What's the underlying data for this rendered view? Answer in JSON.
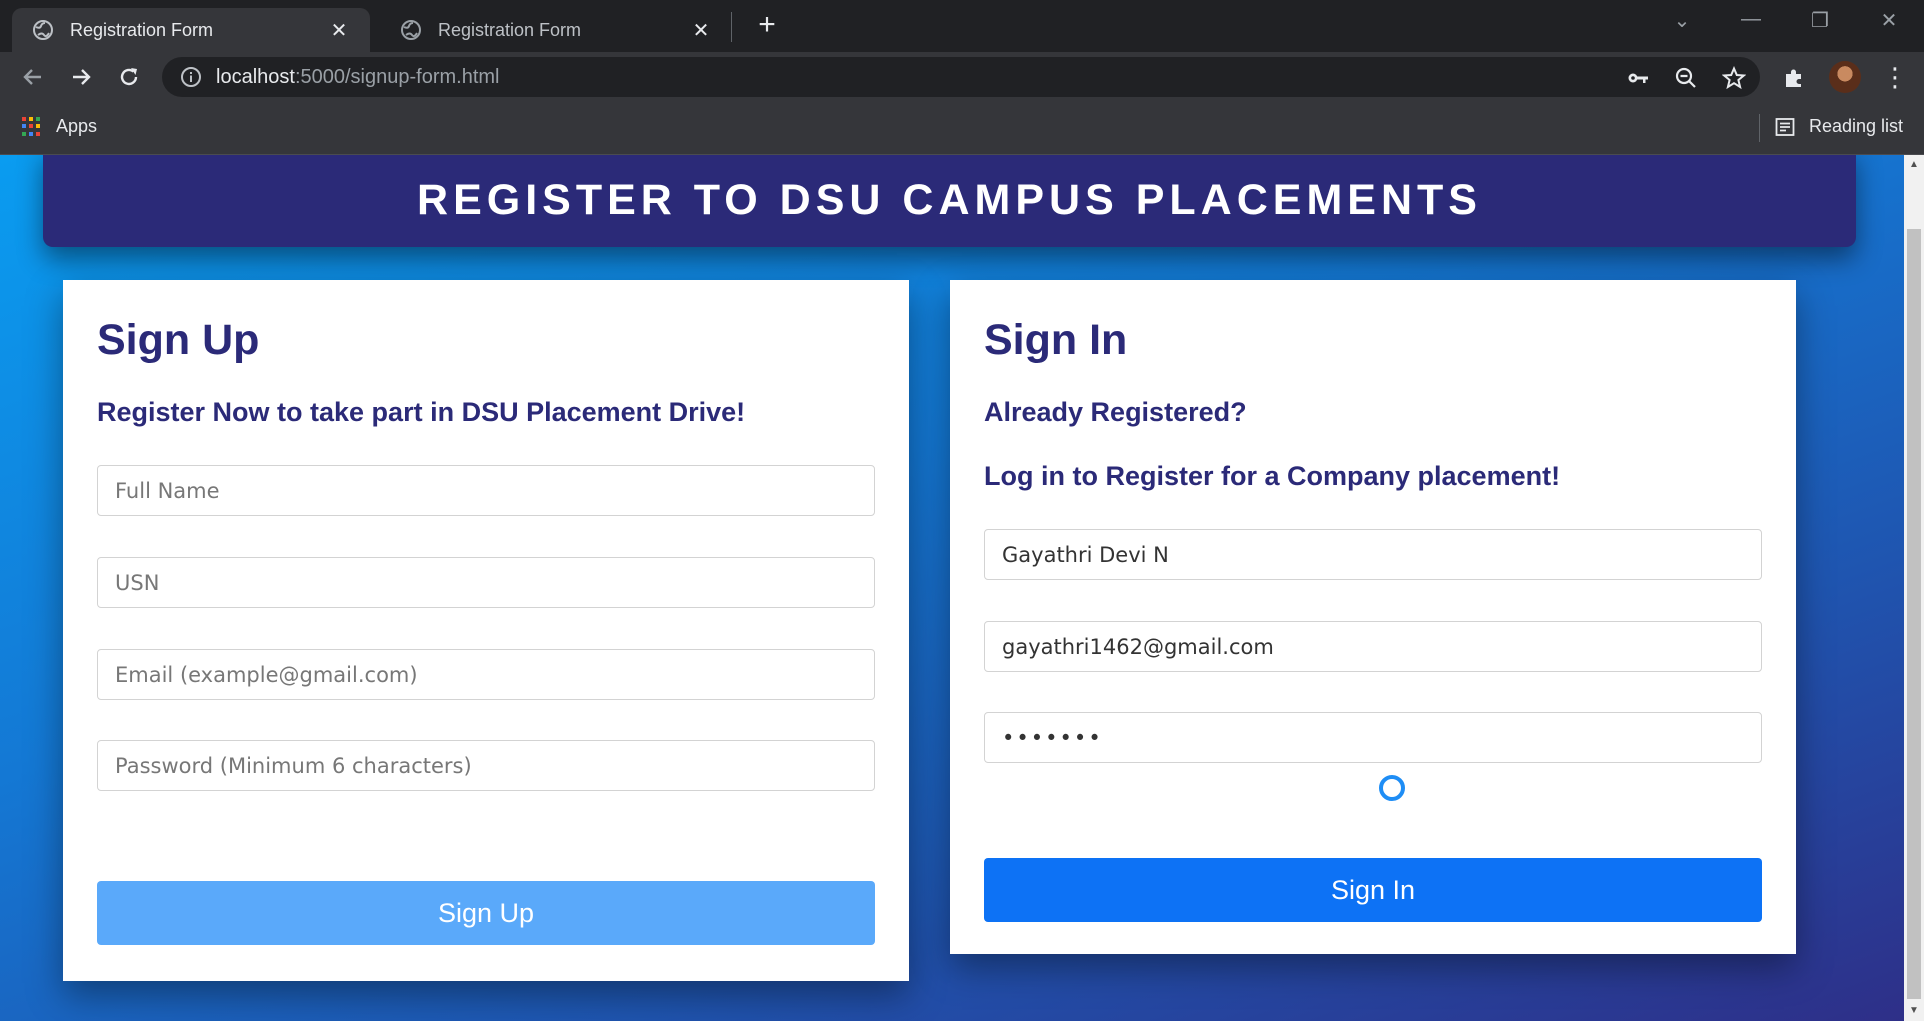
{
  "browser": {
    "tabs": [
      {
        "title": "Registration Form",
        "active": true,
        "icon": "globe-icon"
      },
      {
        "title": "Registration Form",
        "active": false,
        "icon": "globe-icon"
      }
    ],
    "url": {
      "host": "localhost",
      "path": ":5000/signup-form.html"
    },
    "bookmarks": {
      "apps_label": "Apps",
      "reading_list_label": "Reading list"
    }
  },
  "page": {
    "banner_title": "REGISTER TO DSU CAMPUS PLACEMENTS",
    "signup": {
      "heading": "Sign Up",
      "subheading": "Register Now to take part in DSU Placement Drive!",
      "fields": {
        "full_name_placeholder": "Full Name",
        "usn_placeholder": "USN",
        "email_placeholder": "Email (example@gmail.com)",
        "password_placeholder": "Password (Minimum 6 characters)"
      },
      "button_label": "Sign Up"
    },
    "signin": {
      "heading": "Sign In",
      "subheading1": "Already Registered?",
      "subheading2": "Log in to Register for a Company placement!",
      "fields": {
        "name_value": "Gayathri Devi N",
        "email_value": "gayathri1462@gmail.com",
        "password_value": "aaaaaaa"
      },
      "button_label": "Sign In"
    }
  },
  "colors": {
    "brand_navy": "#2b2a78",
    "signup_button": "#5aa9fa",
    "signin_button": "#0d72f5"
  }
}
